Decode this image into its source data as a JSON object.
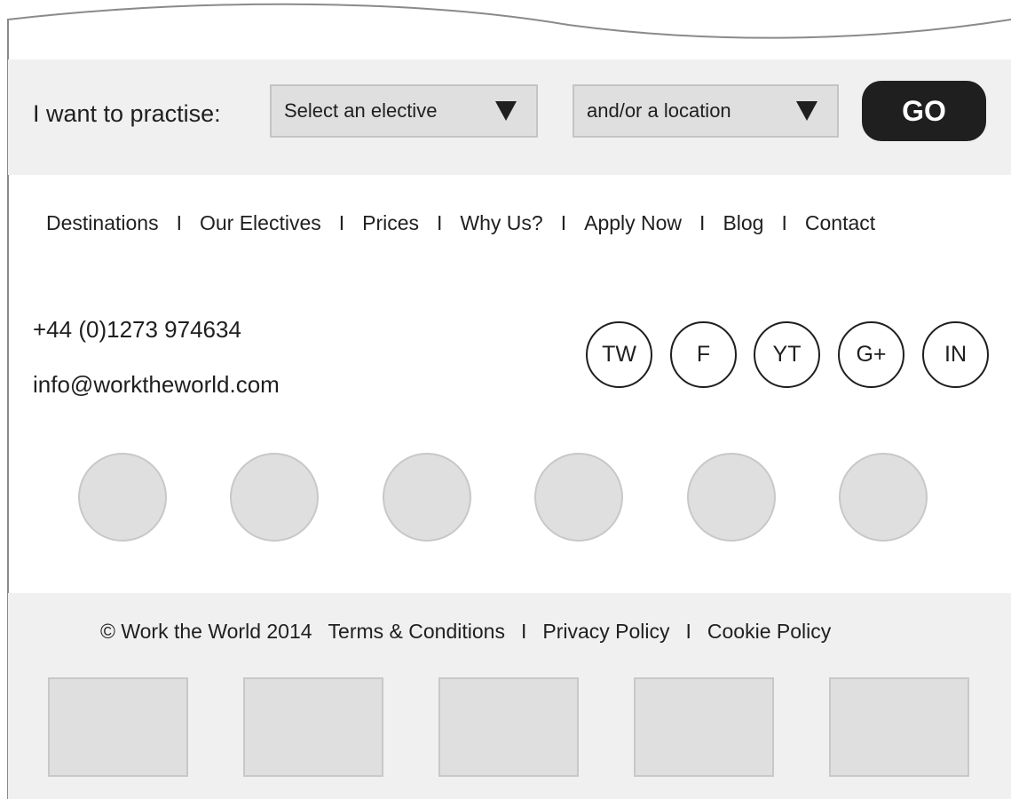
{
  "search": {
    "label": "I want to practise:",
    "elective_select": {
      "value": "Select an elective",
      "icon": "triangle-down-icon"
    },
    "location_select": {
      "value": "and/or a location",
      "icon": "triangle-down-icon"
    },
    "go_label": "GO"
  },
  "nav": {
    "items": [
      {
        "label": "Destinations"
      },
      {
        "label": "Our Electives"
      },
      {
        "label": "Prices"
      },
      {
        "label": "Why Us?"
      },
      {
        "label": "Apply Now"
      },
      {
        "label": "Blog"
      },
      {
        "label": "Contact"
      }
    ],
    "separator": "I"
  },
  "contact": {
    "phone": "+44 (0)1273 974634",
    "email": "info@worktheworld.com"
  },
  "social": [
    {
      "label": "TW"
    },
    {
      "label": "F"
    },
    {
      "label": "YT"
    },
    {
      "label": "G+"
    },
    {
      "label": "IN"
    }
  ],
  "footer": {
    "copyright": "© Work the World 2014",
    "links": [
      {
        "label": "Terms & Conditions"
      },
      {
        "label": "Privacy Policy"
      },
      {
        "label": "Cookie Policy"
      }
    ],
    "separator": "I"
  },
  "colors": {
    "band_background": "#f0f0f1",
    "placeholder_fill": "#dfdfe0",
    "go_button": "#1f1f1f",
    "text": "#1f1f1f"
  }
}
